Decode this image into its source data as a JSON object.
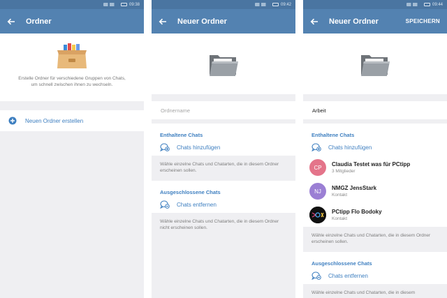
{
  "screens": [
    {
      "status_time": "09:38",
      "title": "Ordner",
      "intro": "Erstelle Ordner für verschiedene Gruppen von Chats, um schnell zwischen ihnen zu wechseln.",
      "create_label": "Neuen Ordner erstellen"
    },
    {
      "status_time": "09:42",
      "title": "Neuer Ordner",
      "name_placeholder": "Ordnername",
      "included_title": "Enthaltene Chats",
      "add_label": "Chats hinzufügen",
      "included_hint": "Wähle einzelne Chats und Chatarten, die in diesem Ordner erscheinen sollen.",
      "excluded_title": "Ausgeschlossene Chats",
      "remove_label": "Chats entfernen",
      "excluded_hint": "Wähle einzelne Chats und Chatarten, die in diesem Ordner nicht erscheinen sollen."
    },
    {
      "status_time": "09:44",
      "title": "Neuer Ordner",
      "save_label": "SPEICHERN",
      "name_value": "Arbeit",
      "included_title": "Enthaltene Chats",
      "add_label": "Chats hinzufügen",
      "chats": [
        {
          "initials": "CP",
          "name": "Claudia Testet was für PCtipp",
          "sub": "3 Mitglieder",
          "color": "#e4748a"
        },
        {
          "initials": "NJ",
          "name": "NMGZ JensStark",
          "sub": "Kontakt",
          "color": "#9b7fd4"
        },
        {
          "initials": "",
          "name": "PCtipp Flo Bodoky",
          "sub": "Kontakt",
          "color": "#111111"
        }
      ],
      "included_hint": "Wähle einzelne Chats und Chatarten, die in diesem Ordner erscheinen sollen.",
      "excluded_title": "Ausgeschlossene Chats",
      "remove_label": "Chats entfernen",
      "excluded_hint": "Wähle einzelne Chats und Chatarten, die in diesem"
    }
  ],
  "colors": {
    "appbar": "#5382b1",
    "accent": "#3e7fc0",
    "background": "#efeff2"
  }
}
